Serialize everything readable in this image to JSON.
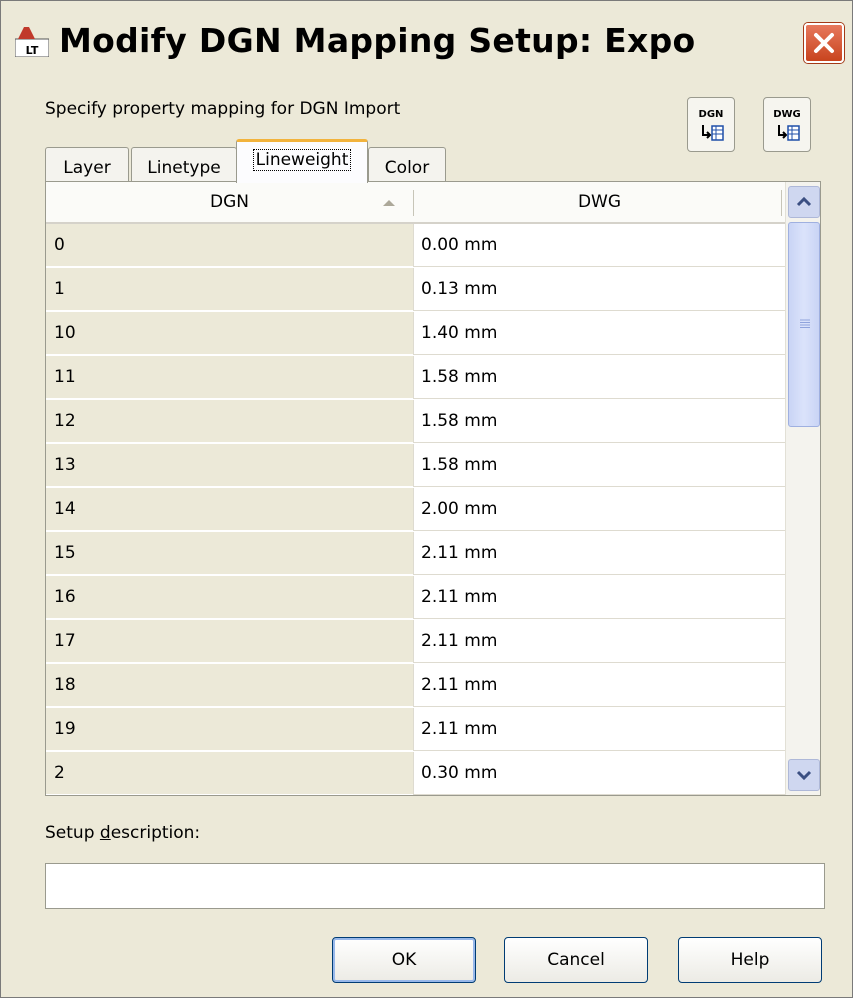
{
  "window": {
    "title": "Modify DGN Mapping Setup: Expo",
    "app_icon": "autocad-lt-icon"
  },
  "instruction": "Specify property mapping for DGN Import",
  "top_buttons": [
    {
      "caption": "DGN",
      "icon": "import-dgn-icon"
    },
    {
      "caption": "DWG",
      "icon": "import-dwg-icon"
    }
  ],
  "tabs": [
    {
      "label": "Layer",
      "active": false
    },
    {
      "label": "Linetype",
      "active": false
    },
    {
      "label": "Lineweight",
      "active": true
    },
    {
      "label": "Color",
      "active": false
    }
  ],
  "table": {
    "columns": [
      "DGN",
      "DWG"
    ],
    "sort_column": "DGN",
    "sort_direction": "ascending",
    "rows": [
      {
        "dgn": "0",
        "dwg": "0.00 mm"
      },
      {
        "dgn": "1",
        "dwg": "0.13 mm"
      },
      {
        "dgn": "10",
        "dwg": "1.40 mm"
      },
      {
        "dgn": "11",
        "dwg": "1.58 mm"
      },
      {
        "dgn": "12",
        "dwg": "1.58 mm"
      },
      {
        "dgn": "13",
        "dwg": "1.58 mm"
      },
      {
        "dgn": "14",
        "dwg": "2.00 mm"
      },
      {
        "dgn": "15",
        "dwg": "2.11 mm"
      },
      {
        "dgn": "16",
        "dwg": "2.11 mm"
      },
      {
        "dgn": "17",
        "dwg": "2.11 mm"
      },
      {
        "dgn": "18",
        "dwg": "2.11 mm"
      },
      {
        "dgn": "19",
        "dwg": "2.11 mm"
      },
      {
        "dgn": "2",
        "dwg": "0.30 mm"
      }
    ]
  },
  "description": {
    "label_before": "Setup ",
    "label_underlined": "d",
    "label_after": "escription:",
    "value": ""
  },
  "buttons": {
    "ok": "OK",
    "cancel": "Cancel",
    "help": "Help"
  },
  "colors": {
    "dialog_bg": "#ece9d8",
    "close_red": "#d9572e",
    "tab_highlight": "#f2b33c",
    "button_border": "#003c74"
  }
}
